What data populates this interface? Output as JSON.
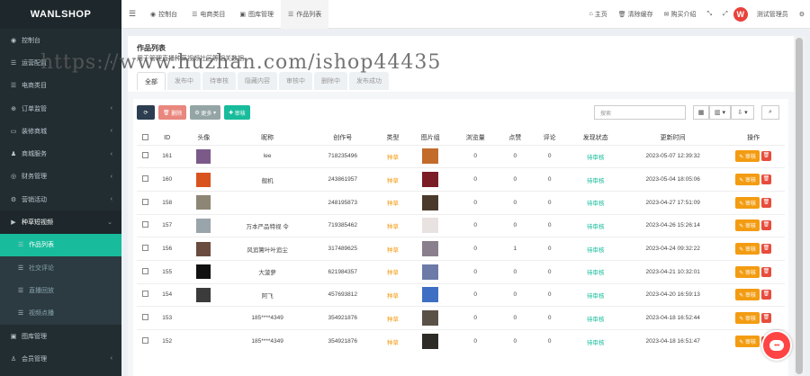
{
  "brand": "WANLSHOP",
  "sidebar": {
    "items": [
      {
        "icon": "dashboard-icon",
        "label": "控制台",
        "arrow": ""
      },
      {
        "icon": "list-icon",
        "label": "运营配置",
        "arrow": "‹"
      },
      {
        "icon": "list-icon",
        "label": "电商类目",
        "arrow": ""
      },
      {
        "icon": "cart-icon",
        "label": "订单监管",
        "arrow": "‹"
      },
      {
        "icon": "monitor-icon",
        "label": "装修商城",
        "arrow": "‹"
      },
      {
        "icon": "users-icon",
        "label": "商城服务",
        "arrow": "‹"
      },
      {
        "icon": "finance-icon",
        "label": "财务管理",
        "arrow": "‹"
      },
      {
        "icon": "gear-icon",
        "label": "营销活动",
        "arrow": "‹"
      },
      {
        "icon": "video-icon",
        "label": "种草短视频",
        "arrow": "⌄"
      }
    ],
    "sub_items": [
      {
        "label": "作品列表",
        "active": true
      },
      {
        "label": "社交评论",
        "active": false
      },
      {
        "label": "直播回放",
        "active": false
      },
      {
        "label": "视频点播",
        "active": false
      }
    ],
    "bottom_items": [
      {
        "icon": "image-icon",
        "label": "图库管理",
        "arrow": ""
      },
      {
        "icon": "user-icon",
        "label": "会员管理",
        "arrow": "‹"
      }
    ]
  },
  "topbar": {
    "tabs": [
      {
        "icon": "dashboard-icon",
        "label": "控制台"
      },
      {
        "icon": "list-icon",
        "label": "电商类目"
      },
      {
        "icon": "image-icon",
        "label": "图库管理"
      },
      {
        "icon": "list-icon",
        "label": "作品列表"
      }
    ],
    "links": [
      {
        "icon": "home-icon",
        "label": "主页"
      },
      {
        "icon": "trash-icon",
        "label": "清除缓存"
      },
      {
        "icon": "chat-icon",
        "label": "购买介绍"
      }
    ],
    "user": "测试管理员",
    "avatar_letter": "W"
  },
  "page": {
    "title": "作品列表",
    "subtitle": "用于管理直播种草视频社区等相关数据"
  },
  "tabs": [
    "全部",
    "发布中",
    "待审核",
    "隐藏内容",
    "审核中",
    "删除中",
    "发布成功"
  ],
  "toolbar": {
    "delete": "删除",
    "more": "更多",
    "review": "审核"
  },
  "search": {
    "placeholder": "搜索"
  },
  "table": {
    "headers": [
      "ID",
      "头像",
      "昵称",
      "创作号",
      "类型",
      "图片组",
      "浏览量",
      "点赞",
      "评论",
      "发现状态",
      "更新时间",
      "操作"
    ],
    "rows": [
      {
        "id": "161",
        "nickname": "lee",
        "uid": "718235496",
        "type": "种草",
        "views": "0",
        "likes": "0",
        "comments": "0",
        "status": "待审核",
        "time": "2023-05-07 12:39:32",
        "avatar": "#7b5a8a",
        "img": "#c26b2a"
      },
      {
        "id": "160",
        "nickname": "舰机",
        "uid": "243861957",
        "type": "种草",
        "views": "0",
        "likes": "0",
        "comments": "0",
        "status": "待审核",
        "time": "2023-05-04 18:05:06",
        "avatar": "#d9531e",
        "img": "#7a1d25"
      },
      {
        "id": "158",
        "nickname": "",
        "uid": "248195873",
        "type": "种草",
        "views": "0",
        "likes": "0",
        "comments": "0",
        "status": "待审核",
        "time": "2023-04-27 17:51:09",
        "avatar": "#8d8676",
        "img": "#4a3a2c"
      },
      {
        "id": "157",
        "nickname": "万本严品特视 令",
        "uid": "719385462",
        "type": "种草",
        "views": "0",
        "likes": "0",
        "comments": "0",
        "status": "待审核",
        "time": "2023-04-26 15:26:14",
        "avatar": "#9aa4ab",
        "img": "#e8e2e0"
      },
      {
        "id": "156",
        "nickname": "风追篱叶叶追尘",
        "uid": "317489625",
        "type": "种草",
        "views": "0",
        "likes": "1",
        "comments": "0",
        "status": "待审核",
        "time": "2023-04-24 09:32:22",
        "avatar": "#6b4b3e",
        "img": "#8a7f8c"
      },
      {
        "id": "155",
        "nickname": "大菠萝",
        "uid": "621984357",
        "type": "种草",
        "views": "0",
        "likes": "0",
        "comments": "0",
        "status": "待审核",
        "time": "2023-04-21 10:32:01",
        "avatar": "#111111",
        "img": "#6c7aa8"
      },
      {
        "id": "154",
        "nickname": "阿飞",
        "uid": "457693812",
        "type": "种草",
        "views": "0",
        "likes": "0",
        "comments": "0",
        "status": "待审核",
        "time": "2023-04-20 16:59:13",
        "avatar": "#3b3b3b",
        "img": "#3f6fc2"
      },
      {
        "id": "153",
        "nickname": "185****4349",
        "uid": "354921876",
        "type": "种草",
        "views": "0",
        "likes": "0",
        "comments": "0",
        "status": "待审核",
        "time": "2023-04-18 16:52:44",
        "avatar": "",
        "img": "#5a5247"
      },
      {
        "id": "152",
        "nickname": "185****4349",
        "uid": "354921876",
        "type": "种草",
        "views": "0",
        "likes": "0",
        "comments": "0",
        "status": "待审核",
        "time": "2023-04-18 16:51:47",
        "avatar": "",
        "img": "#2e2a26"
      }
    ],
    "action_review": "审核"
  },
  "watermark": "https://www.huzhan.com/ishop44435",
  "colors": {
    "sidebar": "#222d32",
    "accent": "#18bc9c",
    "warning": "#f39c12",
    "danger": "#e74c3c"
  }
}
